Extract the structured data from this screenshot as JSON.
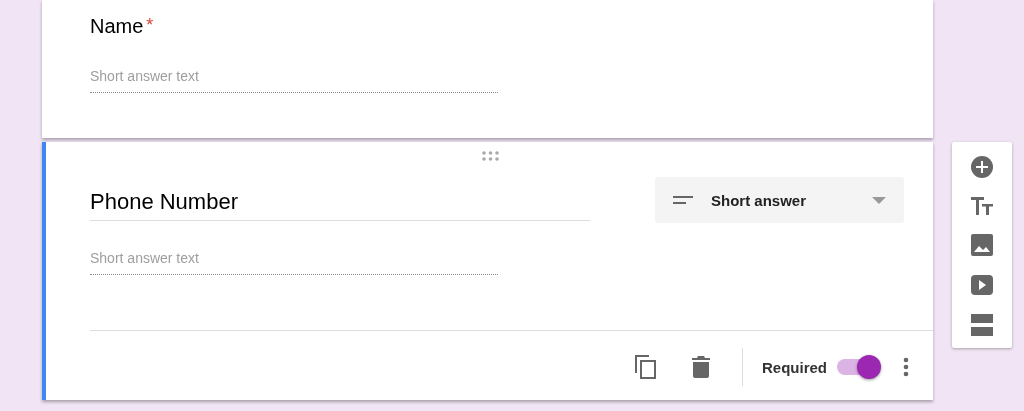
{
  "questions": [
    {
      "title": "Name",
      "required_mark": "*",
      "placeholder": "Short answer text",
      "active": false
    },
    {
      "title": "Phone Number",
      "placeholder": "Short answer text",
      "active": true,
      "type": "Short answer",
      "required_label": "Required",
      "required_on": true
    }
  ]
}
